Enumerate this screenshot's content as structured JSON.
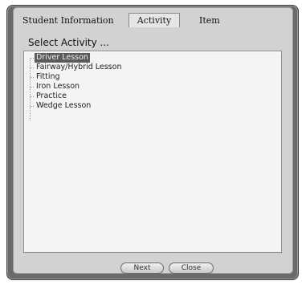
{
  "tabs": [
    {
      "label": "Student Information"
    },
    {
      "label": "Activity"
    },
    {
      "label": "Item"
    }
  ],
  "heading": "Select Activity ...",
  "activities": [
    {
      "label": "Driver Lesson",
      "selected": true
    },
    {
      "label": "Fairway/Hybrid Lesson"
    },
    {
      "label": "Fitting"
    },
    {
      "label": "Iron Lesson"
    },
    {
      "label": "Practice"
    },
    {
      "label": "Wedge Lesson"
    }
  ],
  "buttons": {
    "next": "Next",
    "close": "Close"
  }
}
